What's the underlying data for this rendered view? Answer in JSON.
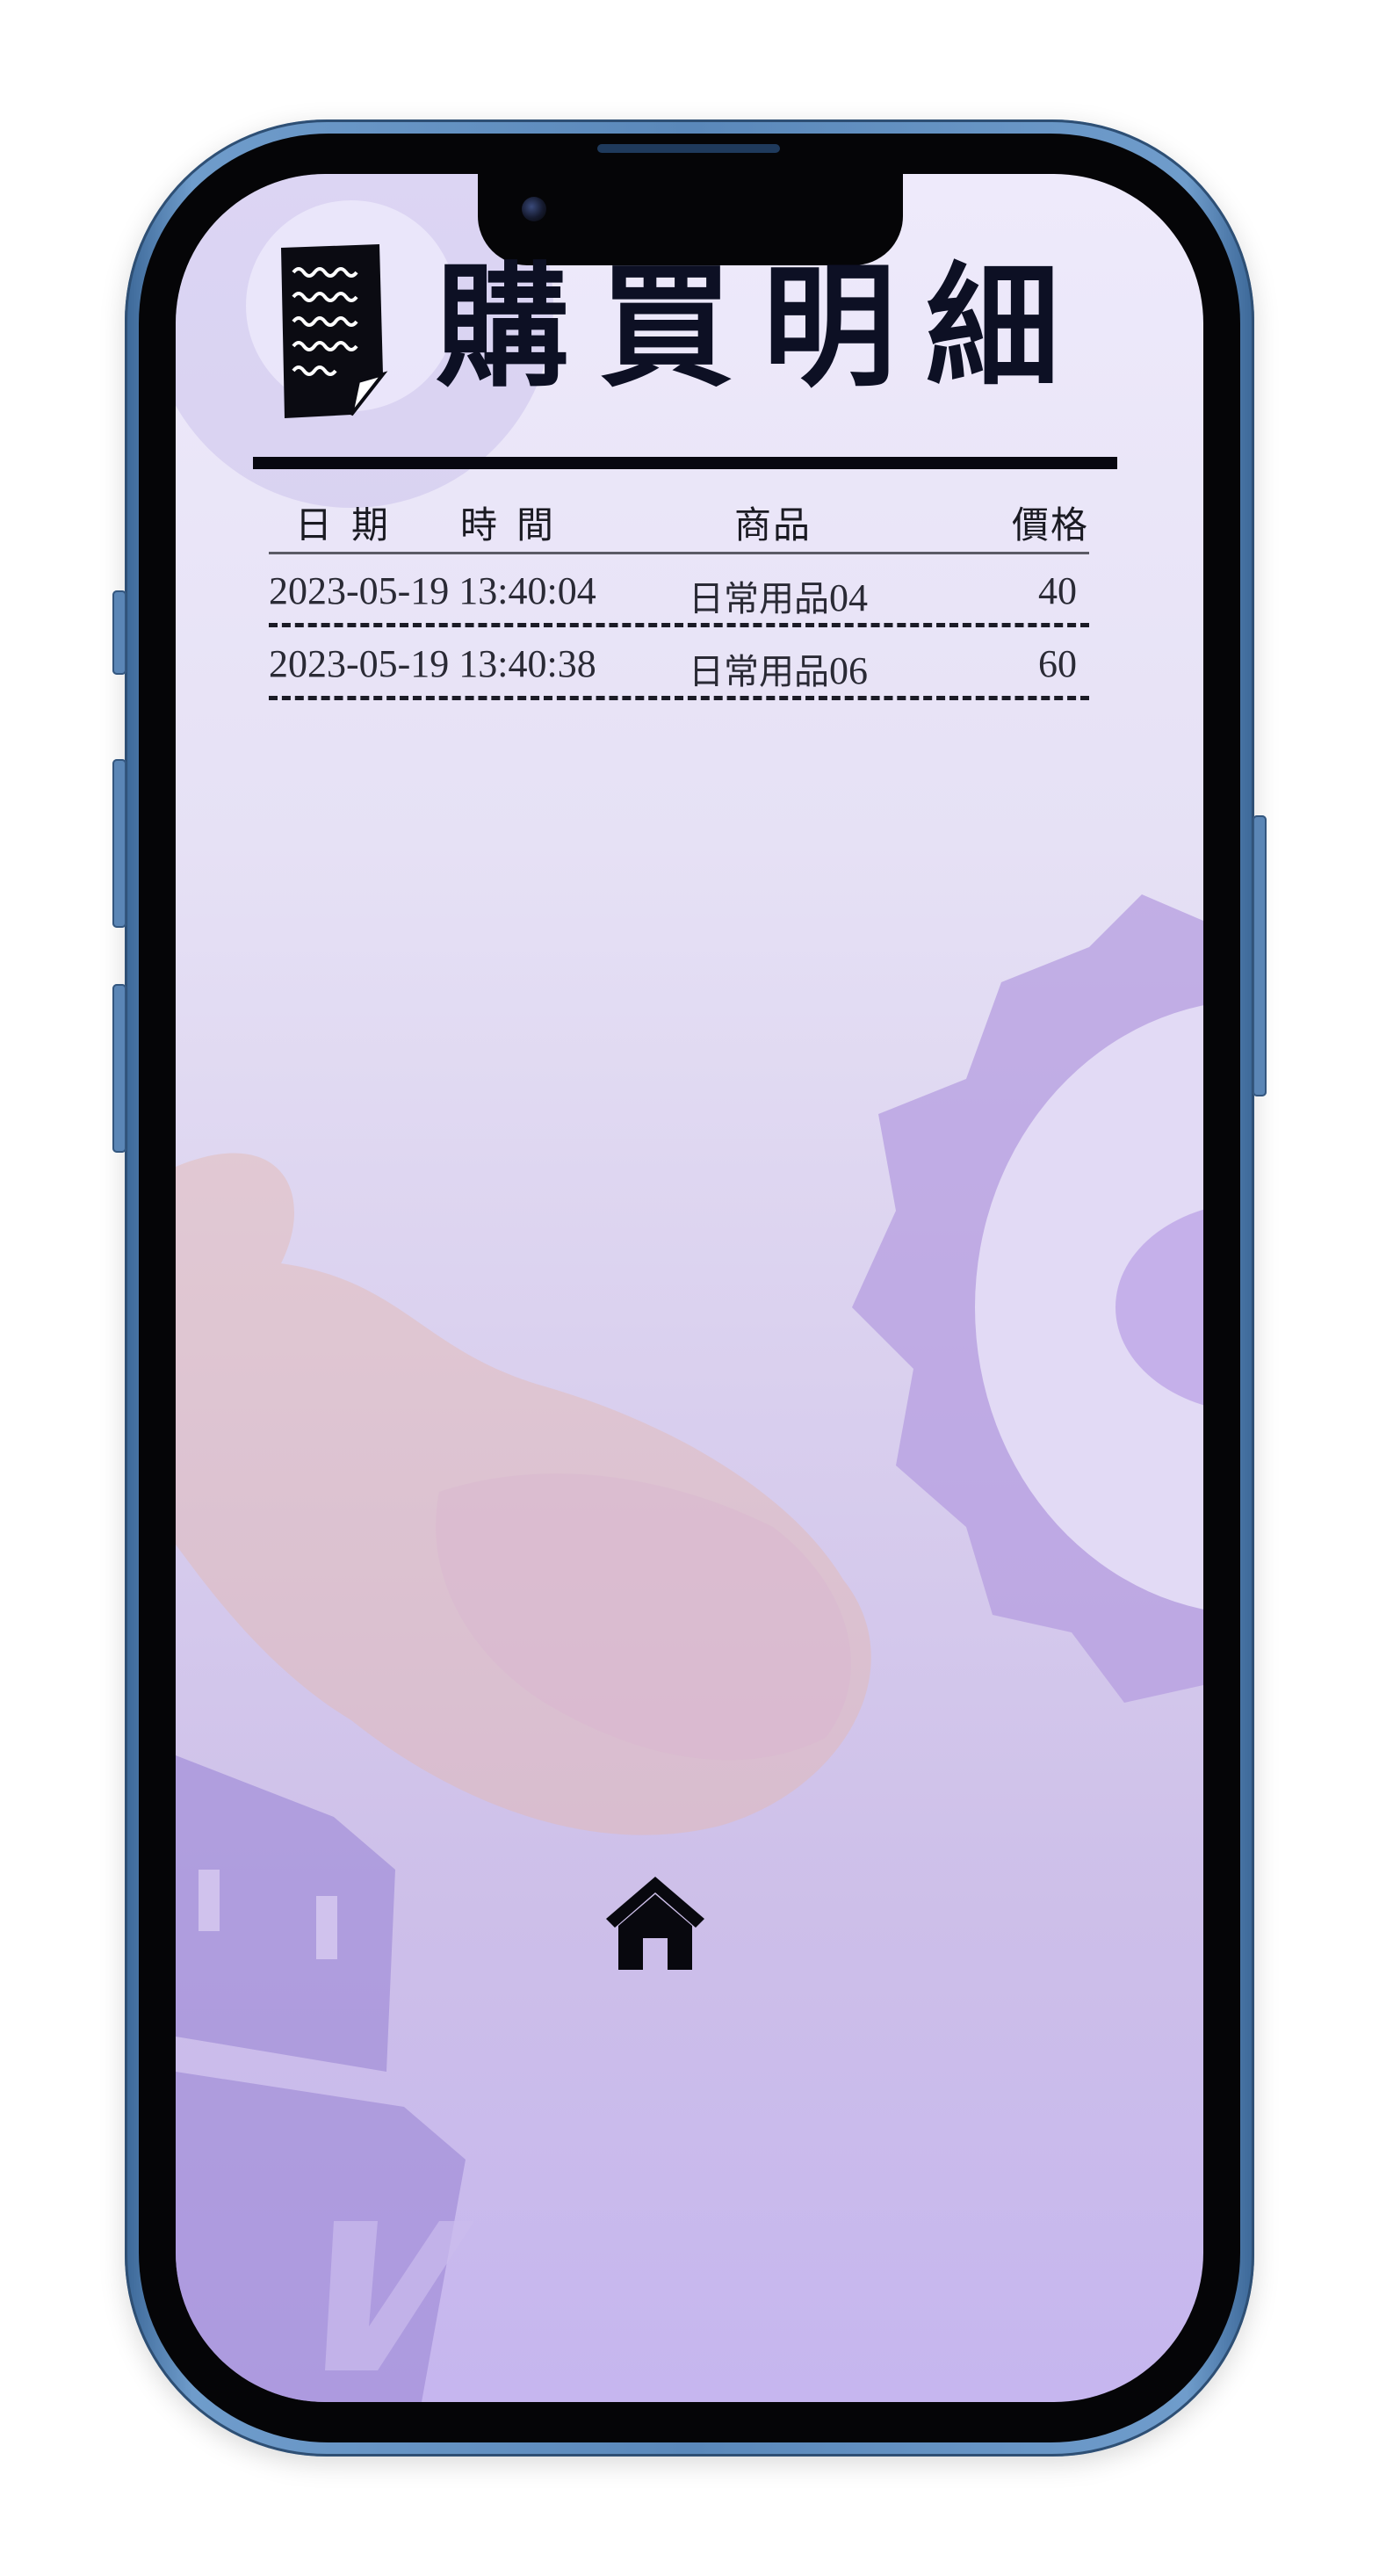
{
  "header": {
    "title": "購買明細",
    "icon": "receipt-icon"
  },
  "table": {
    "columns": {
      "date": "日期",
      "time": "時間",
      "item": "商品",
      "price": "價格"
    },
    "rows": [
      {
        "datetime": "2023-05-19 13:40:04",
        "item_prefix": "日常用品",
        "item_suffix": "04",
        "price": "40"
      },
      {
        "datetime": "2023-05-19 13:40:38",
        "item_prefix": "日常用品",
        "item_suffix": "06",
        "price": "60"
      }
    ]
  },
  "footer": {
    "home_icon": "home-icon"
  },
  "colors": {
    "text_dark": "#0d1024",
    "background_top": "#eeeafb",
    "background_bottom": "#c6b6ef",
    "phone_frame": "#5a88ba"
  }
}
